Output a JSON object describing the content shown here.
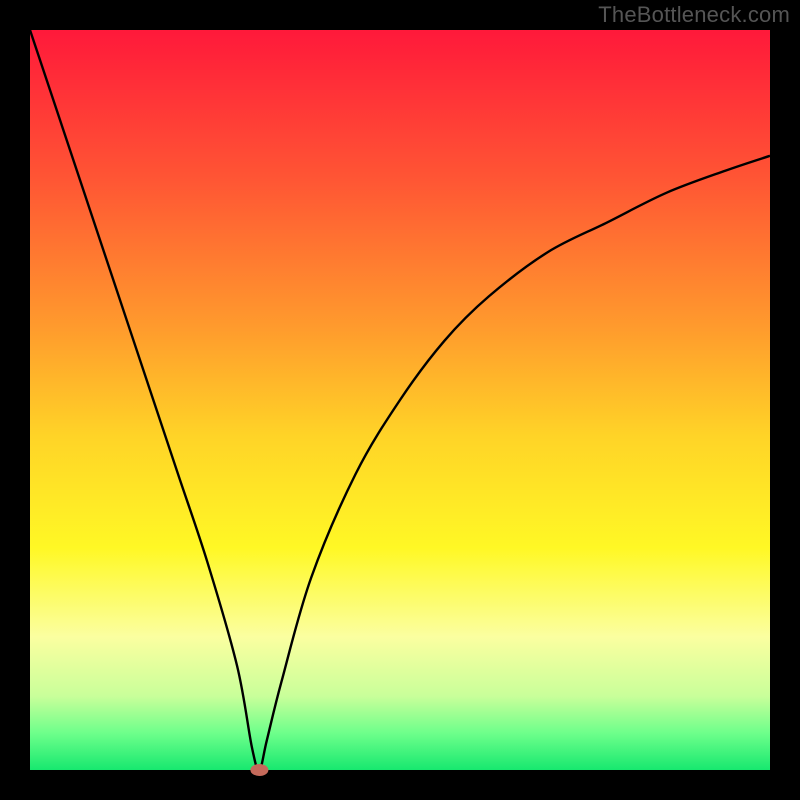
{
  "watermark": "TheBottleneck.com",
  "chart_data": {
    "type": "line",
    "title": "",
    "xlabel": "",
    "ylabel": "",
    "xlim": [
      0,
      100
    ],
    "ylim": [
      0,
      100
    ],
    "x": [
      0,
      4,
      8,
      12,
      16,
      20,
      24,
      28,
      30,
      31,
      32,
      34,
      38,
      44,
      50,
      56,
      62,
      70,
      78,
      86,
      94,
      100
    ],
    "values": [
      100,
      88,
      76,
      64,
      52,
      40,
      28,
      14,
      3,
      0,
      4,
      12,
      26,
      40,
      50,
      58,
      64,
      70,
      74,
      78,
      81,
      83
    ],
    "marker_point": {
      "x": 31,
      "y": 0
    },
    "gradient_stops": [
      {
        "offset": 0.0,
        "color": "#ff193a"
      },
      {
        "offset": 0.2,
        "color": "#ff5534"
      },
      {
        "offset": 0.4,
        "color": "#ff9a2d"
      },
      {
        "offset": 0.55,
        "color": "#ffd427"
      },
      {
        "offset": 0.7,
        "color": "#fff825"
      },
      {
        "offset": 0.82,
        "color": "#fbffa0"
      },
      {
        "offset": 0.9,
        "color": "#c9ff9a"
      },
      {
        "offset": 0.95,
        "color": "#6eff8b"
      },
      {
        "offset": 1.0,
        "color": "#17e86f"
      }
    ],
    "plot_margin": 30
  }
}
